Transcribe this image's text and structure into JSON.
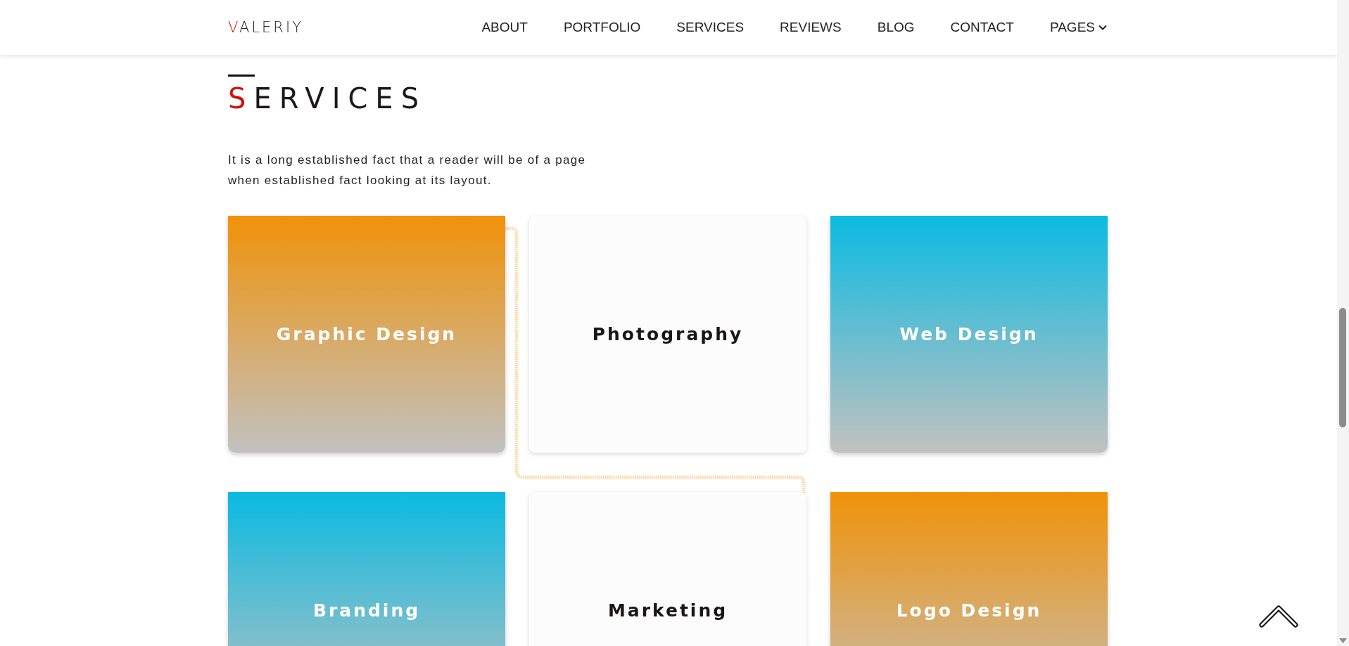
{
  "header": {
    "logo": "VALERIY",
    "nav": [
      {
        "label": "ABOUT",
        "dropdown": false
      },
      {
        "label": "PORTFOLIO",
        "dropdown": false
      },
      {
        "label": "SERVICES",
        "dropdown": false
      },
      {
        "label": "REVIEWS",
        "dropdown": false
      },
      {
        "label": "BLOG",
        "dropdown": false
      },
      {
        "label": "CONTACT",
        "dropdown": false
      },
      {
        "label": "PAGES",
        "dropdown": true
      }
    ]
  },
  "section": {
    "title": "SERVICES",
    "intro": "It is a long established fact that a reader will be of a page when established fact looking at its layout.",
    "cards": [
      {
        "label": "Graphic Design",
        "kind": "orange"
      },
      {
        "label": "Photography",
        "kind": "plain"
      },
      {
        "label": "Web Design",
        "kind": "blue"
      },
      {
        "label": "Branding",
        "kind": "blue"
      },
      {
        "label": "Marketing",
        "kind": "plain"
      },
      {
        "label": "Logo Design",
        "kind": "orange"
      }
    ]
  }
}
